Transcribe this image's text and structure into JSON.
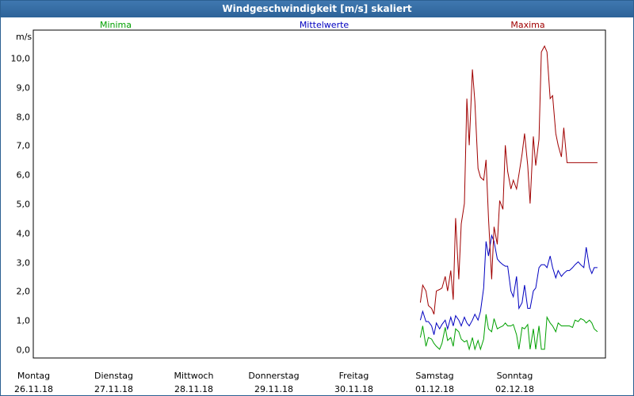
{
  "window": {
    "title": "Windgeschwindigkeit [m/s] skaliert"
  },
  "chart_data": {
    "type": "line",
    "title": "Windgeschwindigkeit [m/s] skaliert",
    "ylabel": "m/s",
    "ylim": [
      -0.3,
      10.95
    ],
    "yticks": [
      {
        "value": 0.0,
        "label": "0,0"
      },
      {
        "value": 1.0,
        "label": "1,0"
      },
      {
        "value": 2.0,
        "label": "2,0"
      },
      {
        "value": 3.0,
        "label": "3,0"
      },
      {
        "value": 4.0,
        "label": "4,0"
      },
      {
        "value": 5.0,
        "label": "5,0"
      },
      {
        "value": 6.0,
        "label": "6,0"
      },
      {
        "value": 7.0,
        "label": "7,0"
      },
      {
        "value": 8.0,
        "label": "8,0"
      },
      {
        "value": 9.0,
        "label": "9,0"
      },
      {
        "value": 10.0,
        "label": "10,0"
      }
    ],
    "xlim": [
      0,
      7.14
    ],
    "xticks": [
      {
        "value": 0,
        "day": "Montag",
        "date": "26.11.18"
      },
      {
        "value": 1,
        "day": "Dienstag",
        "date": "27.11.18"
      },
      {
        "value": 2,
        "day": "Mittwoch",
        "date": "28.11.18"
      },
      {
        "value": 3,
        "day": "Donnerstag",
        "date": "29.11.18"
      },
      {
        "value": 4,
        "day": "Freitag",
        "date": "30.11.18"
      },
      {
        "value": 5,
        "day": "Samstag",
        "date": "01.12.18"
      },
      {
        "value": 6,
        "day": "Sonntag",
        "date": "02.12.18"
      }
    ],
    "grid": true,
    "series": [
      {
        "name": "Minima",
        "color": "#00a000",
        "x": [
          4.83,
          4.86,
          4.9,
          4.93,
          4.97,
          5.0,
          5.03,
          5.07,
          5.1,
          5.14,
          5.17,
          5.21,
          5.24,
          5.27,
          5.31,
          5.34,
          5.38,
          5.41,
          5.44,
          5.48,
          5.51,
          5.55,
          5.58,
          5.62,
          5.65,
          5.68,
          5.72,
          5.75,
          5.79,
          5.82,
          5.86,
          5.89,
          5.92,
          5.96,
          5.99,
          6.03,
          6.06,
          6.1,
          6.13,
          6.17,
          6.2,
          6.24,
          6.27,
          6.31,
          6.34,
          6.38,
          6.41,
          6.45,
          6.48,
          6.52,
          6.55,
          6.59,
          6.62,
          6.66,
          6.69,
          6.73,
          6.76,
          6.8,
          6.83,
          6.87,
          6.9,
          6.94,
          6.97,
          7.0,
          7.04
        ],
        "values": [
          0.4,
          0.8,
          0.1,
          0.4,
          0.35,
          0.2,
          0.1,
          0.0,
          0.2,
          0.75,
          0.3,
          0.4,
          0.1,
          0.7,
          0.6,
          0.35,
          0.25,
          0.3,
          0.0,
          0.4,
          0.0,
          0.3,
          0.0,
          0.35,
          1.2,
          0.7,
          0.6,
          1.05,
          0.7,
          0.75,
          0.8,
          0.9,
          0.8,
          0.8,
          0.85,
          0.5,
          0.0,
          0.75,
          0.7,
          0.85,
          0.0,
          0.7,
          0.0,
          0.8,
          0.0,
          0.0,
          1.1,
          0.9,
          0.8,
          0.6,
          0.9,
          0.8,
          0.8,
          0.8,
          0.8,
          0.75,
          1.0,
          0.95,
          1.05,
          1.0,
          0.9,
          1.0,
          0.9,
          0.7,
          0.6
        ]
      },
      {
        "name": "Mittelwerte",
        "color": "#0000c0",
        "x": [
          4.83,
          4.86,
          4.9,
          4.93,
          4.97,
          5.0,
          5.03,
          5.07,
          5.1,
          5.14,
          5.17,
          5.21,
          5.24,
          5.27,
          5.31,
          5.34,
          5.38,
          5.41,
          5.44,
          5.48,
          5.51,
          5.55,
          5.58,
          5.62,
          5.65,
          5.68,
          5.72,
          5.75,
          5.79,
          5.82,
          5.86,
          5.89,
          5.92,
          5.96,
          5.99,
          6.03,
          6.06,
          6.1,
          6.13,
          6.17,
          6.2,
          6.24,
          6.27,
          6.31,
          6.34,
          6.38,
          6.41,
          6.45,
          6.48,
          6.52,
          6.55,
          6.59,
          6.62,
          6.66,
          6.69,
          6.73,
          6.76,
          6.8,
          6.83,
          6.87,
          6.9,
          6.94,
          6.97,
          7.0,
          7.04
        ],
        "values": [
          1.0,
          1.3,
          0.95,
          0.95,
          0.8,
          0.5,
          0.9,
          0.7,
          0.85,
          1.0,
          0.7,
          1.1,
          0.8,
          1.15,
          1.0,
          0.8,
          1.1,
          0.9,
          0.8,
          1.0,
          1.2,
          1.0,
          1.3,
          2.1,
          3.7,
          3.2,
          3.9,
          3.7,
          3.1,
          3.0,
          2.9,
          2.85,
          2.85,
          2.0,
          1.8,
          2.5,
          1.4,
          1.6,
          2.2,
          1.4,
          1.4,
          2.0,
          2.1,
          2.8,
          2.9,
          2.9,
          2.8,
          3.2,
          2.8,
          2.45,
          2.7,
          2.5,
          2.6,
          2.7,
          2.7,
          2.8,
          2.9,
          3.0,
          2.9,
          2.8,
          3.5,
          2.8,
          2.6,
          2.8,
          2.8
        ]
      },
      {
        "name": "Maxima",
        "color": "#a00000",
        "x": [
          4.83,
          4.86,
          4.9,
          4.93,
          4.97,
          5.0,
          5.03,
          5.07,
          5.1,
          5.14,
          5.17,
          5.21,
          5.24,
          5.27,
          5.31,
          5.34,
          5.38,
          5.41,
          5.44,
          5.48,
          5.51,
          5.55,
          5.58,
          5.62,
          5.65,
          5.68,
          5.72,
          5.75,
          5.79,
          5.82,
          5.86,
          5.89,
          5.92,
          5.96,
          5.99,
          6.03,
          6.06,
          6.1,
          6.13,
          6.17,
          6.2,
          6.24,
          6.27,
          6.31,
          6.34,
          6.38,
          6.41,
          6.45,
          6.48,
          6.52,
          6.55,
          6.59,
          6.62,
          6.66,
          6.69,
          6.73,
          6.76,
          6.8,
          6.83,
          6.87,
          6.9,
          6.94,
          6.97,
          7.0,
          7.04
        ],
        "values": [
          1.6,
          2.2,
          2.0,
          1.5,
          1.4,
          1.2,
          2.0,
          2.05,
          2.1,
          2.5,
          2.0,
          2.7,
          1.7,
          4.5,
          2.4,
          4.3,
          5.0,
          8.6,
          7.0,
          9.6,
          8.5,
          6.2,
          5.9,
          5.8,
          6.5,
          4.5,
          2.4,
          4.2,
          3.6,
          5.1,
          4.8,
          7.0,
          6.1,
          5.5,
          5.8,
          5.5,
          6.0,
          6.7,
          7.4,
          6.3,
          5.0,
          7.3,
          6.3,
          7.2,
          10.2,
          10.4,
          10.2,
          8.6,
          8.7,
          7.4,
          7.0,
          6.6,
          7.6,
          6.4,
          6.4,
          6.4,
          6.4,
          6.4,
          6.4,
          6.4,
          6.4,
          6.4,
          6.4,
          6.4,
          6.4
        ]
      }
    ]
  }
}
